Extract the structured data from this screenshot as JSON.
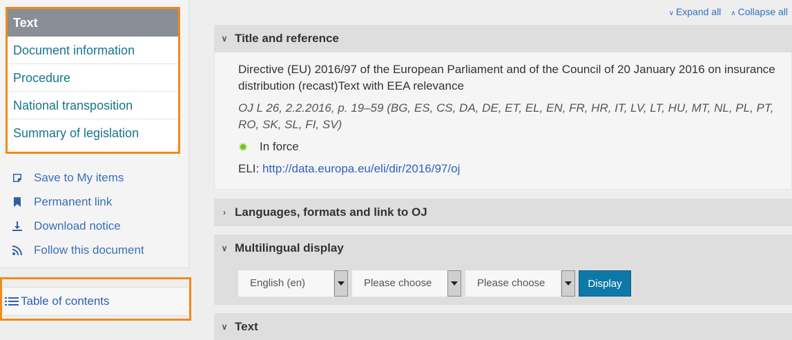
{
  "sidebar": {
    "header": "Text",
    "items": [
      {
        "label": "Document information"
      },
      {
        "label": "Procedure"
      },
      {
        "label": "National transposition"
      },
      {
        "label": "Summary of legislation"
      }
    ],
    "actions": [
      {
        "label": "Save to My items",
        "icon": "note-icon"
      },
      {
        "label": "Permanent link",
        "icon": "bookmark-icon"
      },
      {
        "label": "Download notice",
        "icon": "download-icon"
      },
      {
        "label": "Follow this document",
        "icon": "rss-icon"
      }
    ],
    "toc_label": "Table of contents"
  },
  "toolbar": {
    "expand_all": "Expand all",
    "collapse_all": "Collapse all"
  },
  "sections": {
    "title_reference": {
      "heading": "Title and reference",
      "title": "Directive (EU) 2016/97 of the European Parliament and of the Council of 20 January 2016 on insurance distribution (recast)Text with EEA relevance",
      "oj": "OJ L 26, 2.2.2016, p. 19–59 (BG, ES, CS, DA, DE, ET, EL, EN, FR, HR, IT, LV, LT, HU, MT, NL, PL, PT, RO, SK, SL, FI, SV)",
      "status": "In force",
      "eli_label": "ELI: ",
      "eli_url": "http://data.europa.eu/eli/dir/2016/97/oj"
    },
    "languages": {
      "heading": "Languages, formats and link to OJ"
    },
    "multilingual": {
      "heading": "Multilingual display",
      "select1": "English (en)",
      "select2": "Please choose",
      "select3": "Please choose",
      "display_button": "Display"
    },
    "text": {
      "heading": "Text"
    }
  },
  "colors": {
    "highlight_border": "#f08a1c",
    "link": "#17758f",
    "display_button": "#0e79a8",
    "status_in_force": "#79c11c"
  }
}
